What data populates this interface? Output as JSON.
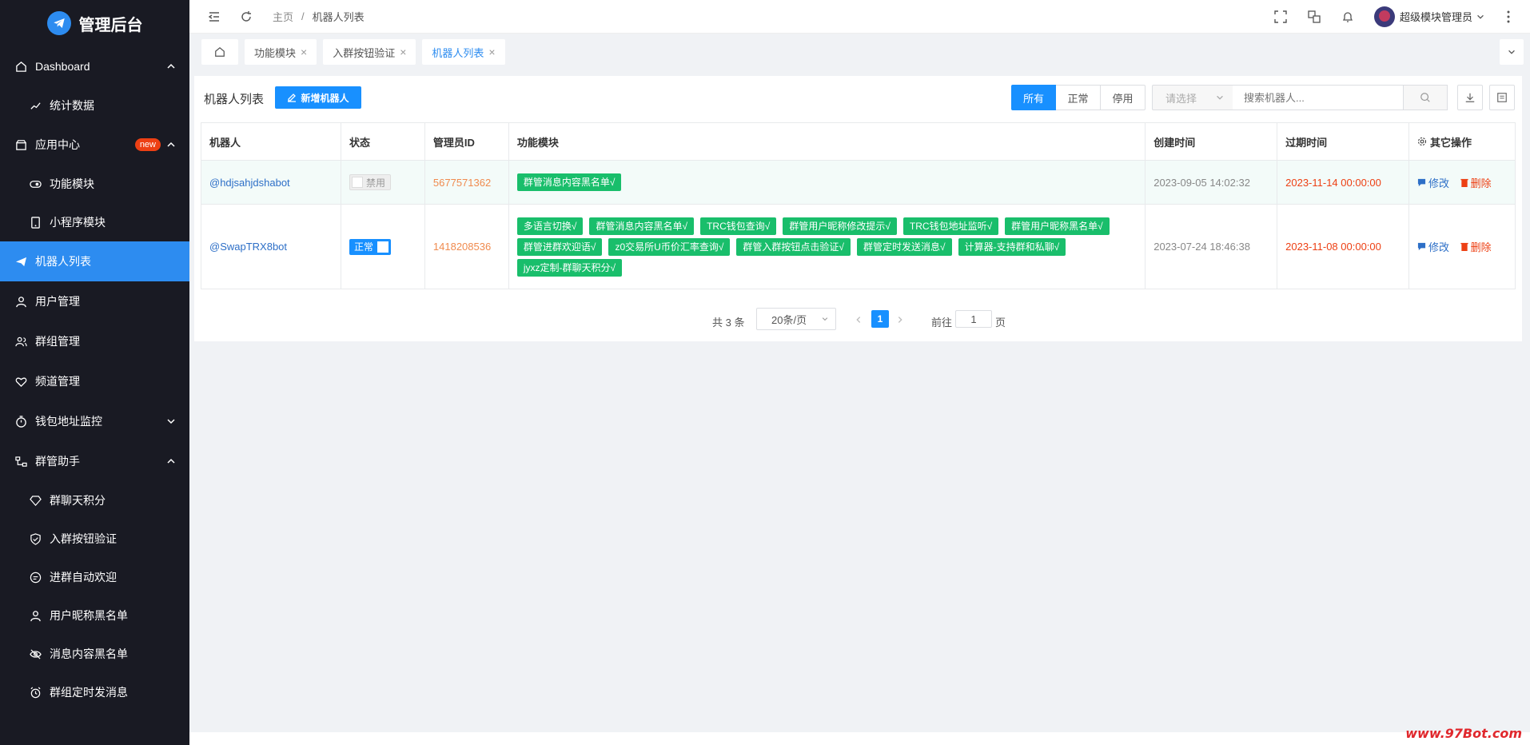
{
  "app": {
    "title": "管理后台"
  },
  "sidebar": {
    "items": [
      {
        "label": "Dashboard"
      },
      {
        "label": "统计数据"
      },
      {
        "label": "应用中心",
        "badge": "new"
      },
      {
        "label": "功能模块"
      },
      {
        "label": "小程序模块"
      },
      {
        "label": "机器人列表"
      },
      {
        "label": "用户管理"
      },
      {
        "label": "群组管理"
      },
      {
        "label": "频道管理"
      },
      {
        "label": "钱包地址监控"
      },
      {
        "label": "群管助手"
      },
      {
        "label": "群聊天积分"
      },
      {
        "label": "入群按钮验证"
      },
      {
        "label": "进群自动欢迎"
      },
      {
        "label": "用户昵称黑名单"
      },
      {
        "label": "消息内容黑名单"
      },
      {
        "label": "群组定时发消息"
      }
    ]
  },
  "header": {
    "breadcrumb": [
      "主页",
      "机器人列表"
    ],
    "separator": "/",
    "user": "超级模块管理员"
  },
  "tabs": [
    {
      "label": "功能模块"
    },
    {
      "label": "入群按钮验证"
    },
    {
      "label": "机器人列表"
    }
  ],
  "page": {
    "title": "机器人列表",
    "add_button": "新增机器人",
    "filters": [
      "所有",
      "正常",
      "停用"
    ],
    "select_placeholder": "请选择",
    "search_placeholder": "搜索机器人..."
  },
  "table": {
    "columns": [
      "机器人",
      "状态",
      "管理员ID",
      "功能模块",
      "创建时间",
      "过期时间",
      "其它操作"
    ],
    "rows": [
      {
        "bot": "@hdjsahjdshabot",
        "status": "禁用",
        "admin_id": "5677571362",
        "modules": [
          "群管消息内容黑名单√"
        ],
        "created": "2023-09-05 14:02:32",
        "expires": "2023-11-14 00:00:00",
        "edit": "修改",
        "delete": "删除"
      },
      {
        "bot": "@SwapTRX8bot",
        "status": "正常",
        "admin_id": "1418208536",
        "modules": [
          "多语言切换√",
          "群管消息内容黑名单√",
          "TRC钱包查询√",
          "群管用户昵称修改提示√",
          "TRC钱包地址监听√",
          "群管用户昵称黑名单√",
          "群管进群欢迎语√",
          "z0交易所U币价汇率查询√",
          "群管入群按钮点击验证√",
          "群管定时发送消息√",
          "计算器-支持群和私聊√",
          "jyxz定制-群聊天积分√"
        ],
        "created": "2023-07-24 18:46:38",
        "expires": "2023-11-08 00:00:00",
        "edit": "修改",
        "delete": "删除"
      }
    ]
  },
  "pagination": {
    "total": "共 3 条",
    "page_size": "20条/页",
    "current": "1",
    "goto_label": "前往",
    "goto_value": "1",
    "page_suffix": "页"
  },
  "watermark": "www.97Bot.com",
  "colors": {
    "accent": "#1890ff",
    "sidebar": "#191a23",
    "tag": "#19be6b",
    "danger": "#ed4014",
    "id": "#f08b4f"
  }
}
